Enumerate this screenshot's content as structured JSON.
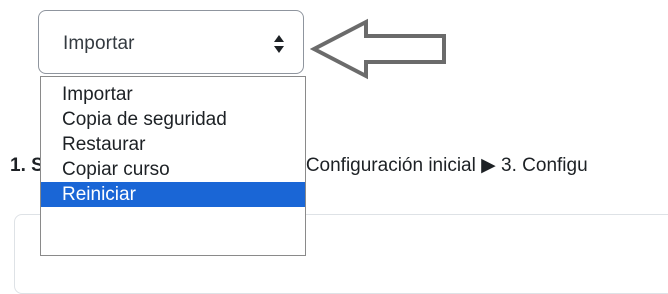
{
  "select": {
    "value": "Importar",
    "options": [
      "Importar",
      "Copia de seguridad",
      "Restaurar",
      "Copiar curso",
      "Reiniciar"
    ],
    "highlighted": "Reiniciar"
  },
  "stepper": {
    "step1": "1. S",
    "step2": "Configuración inicial",
    "separator": "▶",
    "step3": "3. Configu"
  },
  "colors": {
    "highlight": "#1a66d6",
    "arrow": "#6b6b6b"
  }
}
